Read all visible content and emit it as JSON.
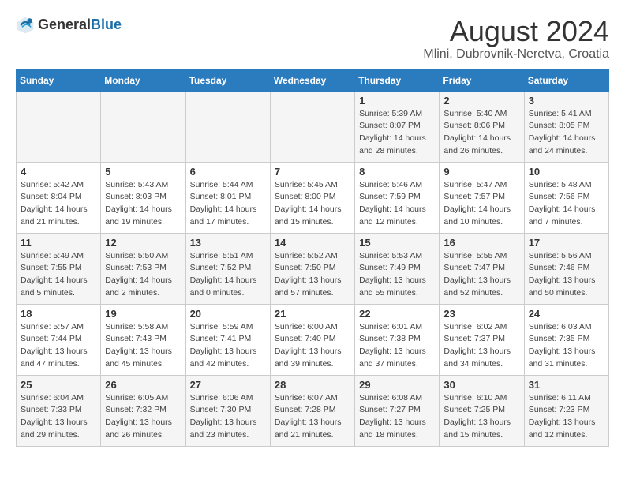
{
  "header": {
    "logo_general": "General",
    "logo_blue": "Blue",
    "month_year": "August 2024",
    "location": "Mlini, Dubrovnik-Neretva, Croatia"
  },
  "weekdays": [
    "Sunday",
    "Monday",
    "Tuesday",
    "Wednesday",
    "Thursday",
    "Friday",
    "Saturday"
  ],
  "weeks": [
    [
      {
        "day": "",
        "info": ""
      },
      {
        "day": "",
        "info": ""
      },
      {
        "day": "",
        "info": ""
      },
      {
        "day": "",
        "info": ""
      },
      {
        "day": "1",
        "info": "Sunrise: 5:39 AM\nSunset: 8:07 PM\nDaylight: 14 hours\nand 28 minutes."
      },
      {
        "day": "2",
        "info": "Sunrise: 5:40 AM\nSunset: 8:06 PM\nDaylight: 14 hours\nand 26 minutes."
      },
      {
        "day": "3",
        "info": "Sunrise: 5:41 AM\nSunset: 8:05 PM\nDaylight: 14 hours\nand 24 minutes."
      }
    ],
    [
      {
        "day": "4",
        "info": "Sunrise: 5:42 AM\nSunset: 8:04 PM\nDaylight: 14 hours\nand 21 minutes."
      },
      {
        "day": "5",
        "info": "Sunrise: 5:43 AM\nSunset: 8:03 PM\nDaylight: 14 hours\nand 19 minutes."
      },
      {
        "day": "6",
        "info": "Sunrise: 5:44 AM\nSunset: 8:01 PM\nDaylight: 14 hours\nand 17 minutes."
      },
      {
        "day": "7",
        "info": "Sunrise: 5:45 AM\nSunset: 8:00 PM\nDaylight: 14 hours\nand 15 minutes."
      },
      {
        "day": "8",
        "info": "Sunrise: 5:46 AM\nSunset: 7:59 PM\nDaylight: 14 hours\nand 12 minutes."
      },
      {
        "day": "9",
        "info": "Sunrise: 5:47 AM\nSunset: 7:57 PM\nDaylight: 14 hours\nand 10 minutes."
      },
      {
        "day": "10",
        "info": "Sunrise: 5:48 AM\nSunset: 7:56 PM\nDaylight: 14 hours\nand 7 minutes."
      }
    ],
    [
      {
        "day": "11",
        "info": "Sunrise: 5:49 AM\nSunset: 7:55 PM\nDaylight: 14 hours\nand 5 minutes."
      },
      {
        "day": "12",
        "info": "Sunrise: 5:50 AM\nSunset: 7:53 PM\nDaylight: 14 hours\nand 2 minutes."
      },
      {
        "day": "13",
        "info": "Sunrise: 5:51 AM\nSunset: 7:52 PM\nDaylight: 14 hours\nand 0 minutes."
      },
      {
        "day": "14",
        "info": "Sunrise: 5:52 AM\nSunset: 7:50 PM\nDaylight: 13 hours\nand 57 minutes."
      },
      {
        "day": "15",
        "info": "Sunrise: 5:53 AM\nSunset: 7:49 PM\nDaylight: 13 hours\nand 55 minutes."
      },
      {
        "day": "16",
        "info": "Sunrise: 5:55 AM\nSunset: 7:47 PM\nDaylight: 13 hours\nand 52 minutes."
      },
      {
        "day": "17",
        "info": "Sunrise: 5:56 AM\nSunset: 7:46 PM\nDaylight: 13 hours\nand 50 minutes."
      }
    ],
    [
      {
        "day": "18",
        "info": "Sunrise: 5:57 AM\nSunset: 7:44 PM\nDaylight: 13 hours\nand 47 minutes."
      },
      {
        "day": "19",
        "info": "Sunrise: 5:58 AM\nSunset: 7:43 PM\nDaylight: 13 hours\nand 45 minutes."
      },
      {
        "day": "20",
        "info": "Sunrise: 5:59 AM\nSunset: 7:41 PM\nDaylight: 13 hours\nand 42 minutes."
      },
      {
        "day": "21",
        "info": "Sunrise: 6:00 AM\nSunset: 7:40 PM\nDaylight: 13 hours\nand 39 minutes."
      },
      {
        "day": "22",
        "info": "Sunrise: 6:01 AM\nSunset: 7:38 PM\nDaylight: 13 hours\nand 37 minutes."
      },
      {
        "day": "23",
        "info": "Sunrise: 6:02 AM\nSunset: 7:37 PM\nDaylight: 13 hours\nand 34 minutes."
      },
      {
        "day": "24",
        "info": "Sunrise: 6:03 AM\nSunset: 7:35 PM\nDaylight: 13 hours\nand 31 minutes."
      }
    ],
    [
      {
        "day": "25",
        "info": "Sunrise: 6:04 AM\nSunset: 7:33 PM\nDaylight: 13 hours\nand 29 minutes."
      },
      {
        "day": "26",
        "info": "Sunrise: 6:05 AM\nSunset: 7:32 PM\nDaylight: 13 hours\nand 26 minutes."
      },
      {
        "day": "27",
        "info": "Sunrise: 6:06 AM\nSunset: 7:30 PM\nDaylight: 13 hours\nand 23 minutes."
      },
      {
        "day": "28",
        "info": "Sunrise: 6:07 AM\nSunset: 7:28 PM\nDaylight: 13 hours\nand 21 minutes."
      },
      {
        "day": "29",
        "info": "Sunrise: 6:08 AM\nSunset: 7:27 PM\nDaylight: 13 hours\nand 18 minutes."
      },
      {
        "day": "30",
        "info": "Sunrise: 6:10 AM\nSunset: 7:25 PM\nDaylight: 13 hours\nand 15 minutes."
      },
      {
        "day": "31",
        "info": "Sunrise: 6:11 AM\nSunset: 7:23 PM\nDaylight: 13 hours\nand 12 minutes."
      }
    ]
  ]
}
